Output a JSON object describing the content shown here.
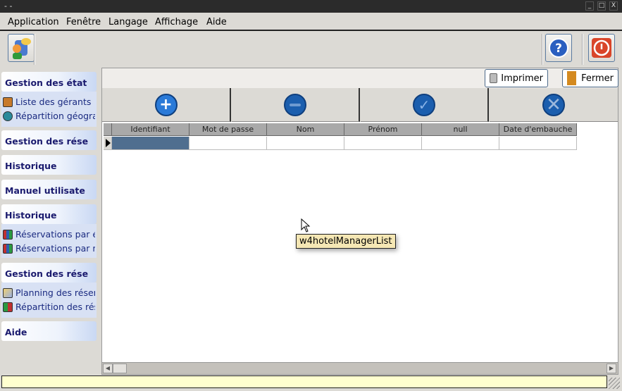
{
  "window": {
    "title": "- -",
    "controls": [
      "_",
      "□",
      "X"
    ]
  },
  "menubar": {
    "items": [
      "Application",
      "Fenêtre",
      "Langage",
      "Affichage",
      "Aide"
    ]
  },
  "toolbar": {
    "app_icon": "users-chat-icon",
    "help_icon": "help-icon",
    "exit_icon": "power-icon"
  },
  "sidebar": {
    "sections": [
      {
        "title": "Gestion des état",
        "items": [
          {
            "label": "Liste des gérants",
            "icon": "person-icon"
          },
          {
            "label": "Répartition géogra",
            "icon": "globe-icon"
          }
        ]
      },
      {
        "title": "Gestion des rése",
        "items": []
      },
      {
        "title": "Historique",
        "items": []
      },
      {
        "title": "Manuel utilisate",
        "items": []
      },
      {
        "title": "Historique",
        "items": [
          {
            "label": "Réservations par él",
            "icon": "bar-chart-icon"
          },
          {
            "label": "Réservations par m",
            "icon": "bar-chart-icon"
          }
        ]
      },
      {
        "title": "Gestion des rése",
        "items": [
          {
            "label": "Planning des réserv",
            "icon": "planning-icon"
          },
          {
            "label": "Répartition des rés",
            "icon": "chart-icon"
          }
        ]
      },
      {
        "title": "Aide",
        "items": []
      }
    ]
  },
  "main": {
    "print_label": "Imprimer",
    "close_label": "Fermer",
    "actions": [
      "add",
      "remove",
      "validate",
      "cancel"
    ],
    "table": {
      "columns": [
        "Identifiant",
        "Mot de passe",
        "Nom",
        "Prénom",
        "null",
        "Date d'embauche"
      ],
      "rows": [
        [
          "",
          "",
          "",
          "",
          "",
          ""
        ]
      ]
    }
  },
  "tooltip": "w4hotelManagerList",
  "status": ""
}
